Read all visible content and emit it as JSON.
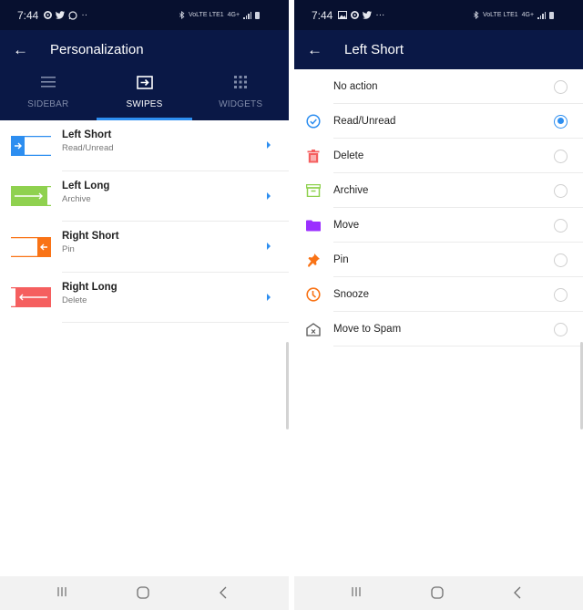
{
  "left_screen": {
    "status": {
      "time": "7:44",
      "notification_icons": [
        "camera-app-icon",
        "twitter-icon",
        "whatsapp-icon",
        "more-dots"
      ],
      "right_text": [
        "VoLTE LTE1",
        "4G+"
      ]
    },
    "appbar": {
      "title": "Personalization"
    },
    "tabs": [
      {
        "label": "SIDEBAR",
        "icon": "menu-icon",
        "active": false
      },
      {
        "label": "SWIPES",
        "icon": "swipe-icon",
        "active": true
      },
      {
        "label": "WIDGETS",
        "icon": "grid-icon",
        "active": false
      }
    ],
    "swipes": [
      {
        "title": "Left Short",
        "action": "Read/Unread",
        "color": "#2d8ef0"
      },
      {
        "title": "Left Long",
        "action": "Archive",
        "color": "#8fd14f"
      },
      {
        "title": "Right Short",
        "action": "Pin",
        "color": "#f97316"
      },
      {
        "title": "Right Long",
        "action": "Delete",
        "color": "#f55f5f"
      }
    ]
  },
  "right_screen": {
    "status": {
      "time": "7:44",
      "notification_icons": [
        "gallery-icon",
        "camera-app-icon",
        "twitter-icon",
        "more-dots"
      ],
      "right_text": [
        "VoLTE LTE1",
        "4G+"
      ]
    },
    "appbar": {
      "title": "Left Short"
    },
    "options": [
      {
        "label": "No action",
        "icon": "",
        "color": "",
        "selected": false
      },
      {
        "label": "Read/Unread",
        "icon": "check-circle-icon",
        "color": "#2d8ef0",
        "selected": true
      },
      {
        "label": "Delete",
        "icon": "trash-icon",
        "color": "#f55f5f",
        "selected": false
      },
      {
        "label": "Archive",
        "icon": "archive-icon",
        "color": "#8fd14f",
        "selected": false
      },
      {
        "label": "Move",
        "icon": "folder-icon",
        "color": "#9b30ff",
        "selected": false
      },
      {
        "label": "Pin",
        "icon": "pin-icon",
        "color": "#f97316",
        "selected": false
      },
      {
        "label": "Snooze",
        "icon": "clock-icon",
        "color": "#f97316",
        "selected": false
      },
      {
        "label": "Move to Spam",
        "icon": "spam-icon",
        "color": "#555555",
        "selected": false
      }
    ]
  },
  "colors": {
    "statusbar": "#07102f",
    "appbar": "#0a1846",
    "accent": "#2d8ef0"
  },
  "icons": {
    "back": "←"
  }
}
